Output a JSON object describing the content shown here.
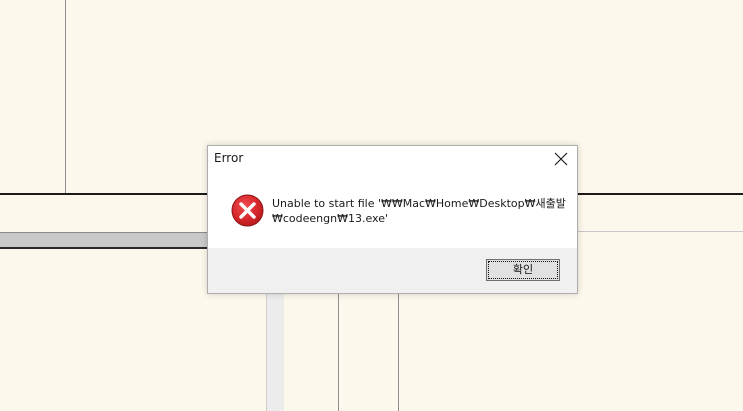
{
  "dialog": {
    "title": "Error",
    "message_lines": [
      "Unable to start file '₩₩Mac₩Home₩Desktop₩새출발",
      "₩codeengn₩13.exe'"
    ],
    "ok_label": "확인",
    "icons": {
      "close": "close-icon",
      "error": "error-icon"
    },
    "colors": {
      "error_red": "#d3262a",
      "footer_bg": "#f0f0f0"
    }
  },
  "background": {
    "canvas_color": "#fdf8ec"
  }
}
